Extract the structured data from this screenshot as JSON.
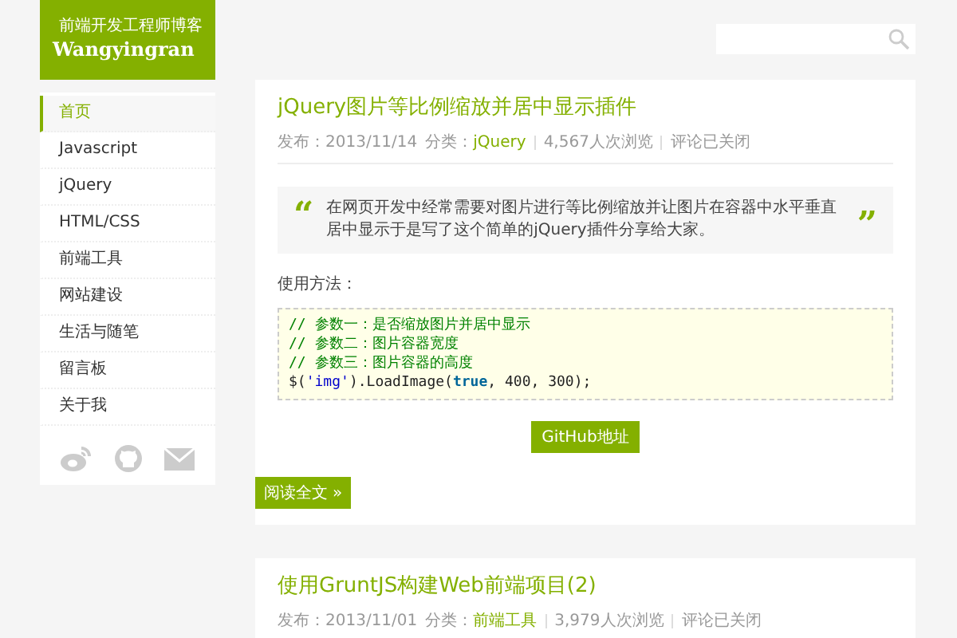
{
  "logo": {
    "name": "Wangyingran",
    "tagline": "前端开发工程师博客"
  },
  "nav": [
    {
      "label": "首页",
      "selected": true
    },
    {
      "label": "Javascript",
      "selected": false
    },
    {
      "label": "jQuery",
      "selected": false
    },
    {
      "label": "HTML/CSS",
      "selected": false
    },
    {
      "label": "前端工具",
      "selected": false
    },
    {
      "label": "网站建设",
      "selected": false
    },
    {
      "label": "生活与随笔",
      "selected": false
    },
    {
      "label": "留言板",
      "selected": false
    },
    {
      "label": "关于我",
      "selected": false
    }
  ],
  "social": [
    {
      "kind": "weibo"
    },
    {
      "kind": "github"
    },
    {
      "kind": "mail"
    }
  ],
  "posts": [
    {
      "title": "jQuery图片等比例缩放并居中显示插件",
      "meta": {
        "date": "发布：2013/11/14",
        "category_label": "分类：",
        "category": "jQuery",
        "views": "4,567人次浏览",
        "comments": "评论已关闭"
      },
      "quote": {
        "open": "“",
        "text": "在网页开发中经常需要对图片进行等比例缩放并让图片在容器中水平垂直居中显示于是写了这个简单的jQuery插件分享给大家。",
        "close": "”"
      },
      "usage_heading": "使用方法：",
      "code": [
        {
          "tokens": [
            {
              "kind": "comment",
              "text": "// 参数一：是否缩放图片并居中显示"
            }
          ]
        },
        {
          "tokens": [
            {
              "kind": "comment",
              "text": "// 参数二：图片容器宽度"
            }
          ]
        },
        {
          "tokens": [
            {
              "kind": "comment",
              "text": "// 参数三：图片容器的高度"
            }
          ]
        },
        {
          "tokens": [
            {
              "kind": "plain",
              "text": "$("
            },
            {
              "kind": "string",
              "text": "'img'"
            },
            {
              "kind": "plain",
              "text": ").LoadImage("
            },
            {
              "kind": "keyword",
              "text": "true"
            },
            {
              "kind": "plain",
              "text": ", 400, 300);"
            }
          ]
        }
      ],
      "button": "GitHub地址",
      "read_more": "阅读全文 »"
    },
    {
      "title": "使用GruntJS构建Web前端项目(2)",
      "meta": {
        "date": "发布：2013/11/01",
        "category_label": "分类：",
        "category": "前端工具",
        "views": "3,979人次浏览",
        "comments": "评论已关闭"
      }
    }
  ]
}
